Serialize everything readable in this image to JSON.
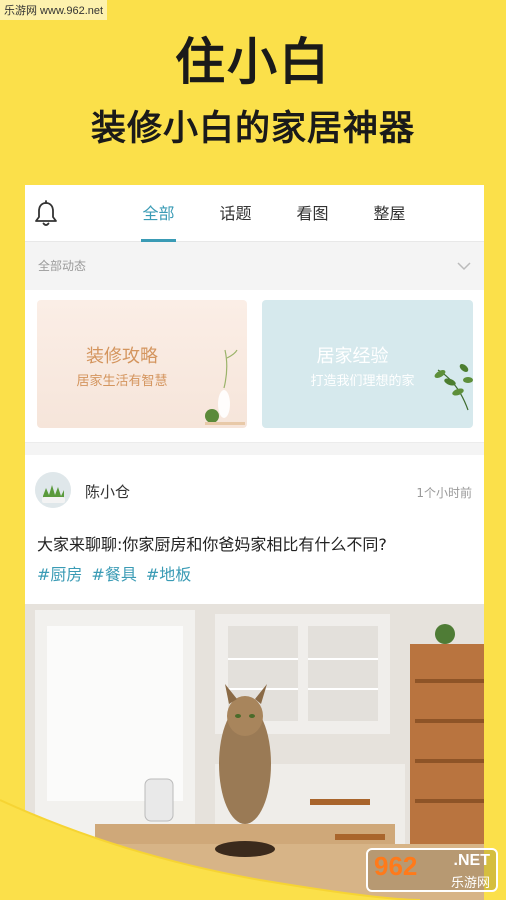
{
  "watermark": "乐游网 www.962.net",
  "headline": {
    "title": "住小白",
    "subtitle": "装修小白的家居神器"
  },
  "topbar": {
    "tabs": [
      {
        "label": "全部",
        "active": true
      },
      {
        "label": "话题",
        "active": false
      },
      {
        "label": "看图",
        "active": false
      },
      {
        "label": "整屋",
        "active": false
      }
    ]
  },
  "filter": {
    "label": "全部动态"
  },
  "cards": [
    {
      "title": "装修攻略",
      "subtitle": "居家生活有智慧"
    },
    {
      "title": "居家经验",
      "subtitle": "打造我们理想的家"
    }
  ],
  "post": {
    "author": "陈小仓",
    "time": "1个小时前",
    "content": "大家来聊聊:你家厨房和你爸妈家相比有什么不同?",
    "tags": [
      "#厨房",
      "#餐具",
      "#地板"
    ]
  },
  "logo": {
    "number": "962",
    "suffix": ".NET",
    "cn": "乐游网"
  },
  "colors": {
    "background": "#fbe04a",
    "accent": "#3a9bb5"
  }
}
